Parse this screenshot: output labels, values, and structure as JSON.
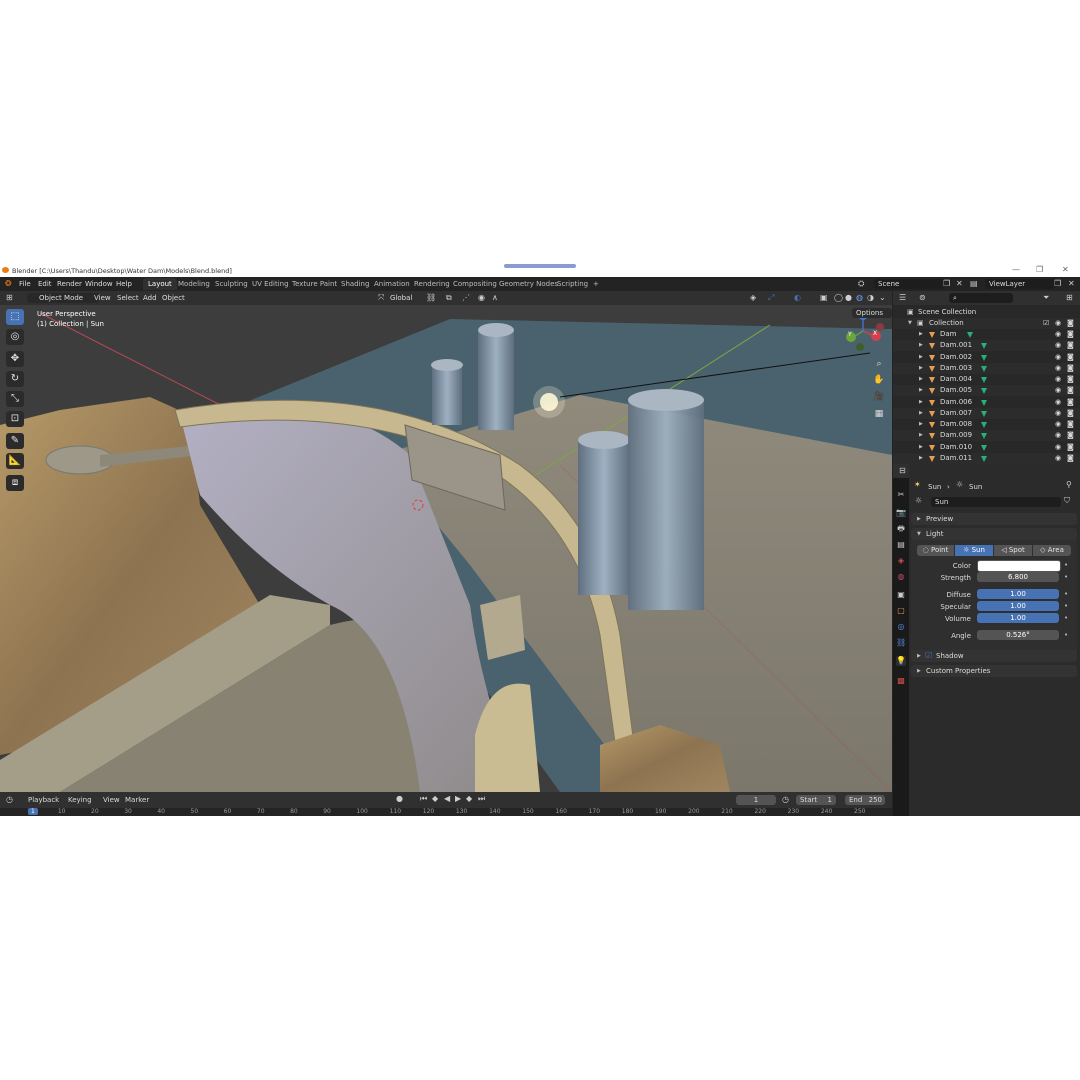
{
  "window": {
    "title": "Blender [C:\\Users\\Thandu\\Desktop\\Water Dam\\Models\\Blend.blend]",
    "controls": [
      "—",
      "❐",
      "✕"
    ]
  },
  "menu": [
    "File",
    "Edit",
    "Render",
    "Window",
    "Help"
  ],
  "workspaces": [
    "Layout",
    "Modeling",
    "Sculpting",
    "UV Editing",
    "Texture Paint",
    "Shading",
    "Animation",
    "Rendering",
    "Compositing",
    "Geometry Nodes",
    "Scripting",
    "+"
  ],
  "scene": {
    "name": "Scene",
    "view_layer": "ViewLayer"
  },
  "viewport_header": {
    "mode": "Object Mode",
    "menus": [
      "View",
      "Select",
      "Add",
      "Object"
    ],
    "transform": "Global",
    "options": "Options"
  },
  "viewport": {
    "view_name": "User Perspective",
    "context": "(1) Collection | Sun",
    "gizmo": {
      "z": "Z",
      "x": "X",
      "y": "Y"
    }
  },
  "outliner": {
    "scene_collection": "Scene Collection",
    "collection": "Collection",
    "items": [
      "Dam",
      "Dam.001",
      "Dam.002",
      "Dam.003",
      "Dam.004",
      "Dam.005",
      "Dam.006",
      "Dam.007",
      "Dam.008",
      "Dam.009",
      "Dam.010",
      "Dam.011"
    ]
  },
  "properties": {
    "breadcrumb": [
      "Sun",
      "Sun"
    ],
    "data_name": "Sun",
    "panels": {
      "preview": "Preview",
      "light": "Light",
      "shadow": "Shadow",
      "custom": "Custom Properties"
    },
    "light_types": [
      "Point",
      "Sun",
      "Spot",
      "Area"
    ],
    "active_light_type": "Sun",
    "fields": {
      "color_label": "Color",
      "color_value": "#ffffff",
      "strength_label": "Strength",
      "strength": "6.800",
      "diffuse_label": "Diffuse",
      "diffuse": "1.00",
      "specular_label": "Specular",
      "specular": "1.00",
      "volume_label": "Volume",
      "volume": "1.00",
      "angle_label": "Angle",
      "angle": "0.526°"
    }
  },
  "timeline": {
    "menus": [
      "Playback",
      "Keying",
      "View",
      "Marker"
    ],
    "current_frame": "1",
    "start_label": "Start",
    "start": "1",
    "end_label": "End",
    "end": "250",
    "ticks": [
      "1",
      "10",
      "20",
      "30",
      "40",
      "50",
      "60",
      "70",
      "80",
      "90",
      "100",
      "110",
      "120",
      "130",
      "140",
      "150",
      "160",
      "170",
      "180",
      "190",
      "200",
      "210",
      "220",
      "230",
      "240",
      "250"
    ]
  },
  "colors": {
    "accent": "#4772b3",
    "mesh": "#e69e52",
    "modifier": "#26b07a",
    "header": "#303030"
  }
}
